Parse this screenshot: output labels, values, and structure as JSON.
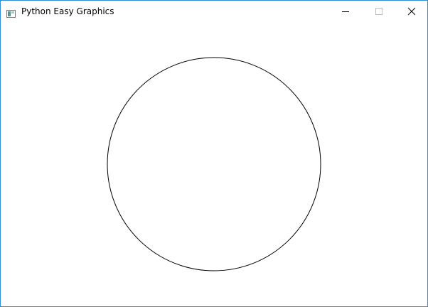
{
  "window": {
    "title": "Python Easy Graphics",
    "app_icon": "window-app-icon",
    "controls": {
      "minimize_icon": "minimize-icon",
      "maximize_icon": "maximize-icon",
      "close_icon": "close-icon"
    }
  },
  "canvas": {
    "background": "#ffffff",
    "shapes": [
      {
        "type": "circle",
        "stroke": "#000000",
        "fill": "none"
      }
    ]
  },
  "colors": {
    "window_border": "#2b8fd8",
    "icon_accent": "#5f8f8a"
  }
}
